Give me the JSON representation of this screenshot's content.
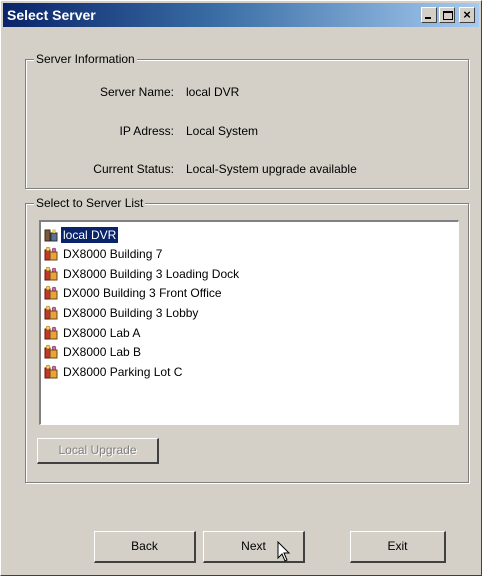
{
  "window": {
    "title": "Select Server"
  },
  "server_info": {
    "legend": "Server Information",
    "name_label": "Server Name:",
    "name_value": "local DVR",
    "ip_label": "IP Adress:",
    "ip_value": "Local System",
    "status_label": "Current Status:",
    "status_value": "Local-System upgrade available"
  },
  "server_list": {
    "legend": "Select to Server List",
    "items": [
      {
        "label": "local DVR",
        "icon": "dvr-icon"
      },
      {
        "label": "DX8000 Building 7",
        "icon": "server-icon"
      },
      {
        "label": "DX8000 Building 3 Loading Dock",
        "icon": "server-icon"
      },
      {
        "label": "DX000 Building 3 Front Office",
        "icon": "server-icon"
      },
      {
        "label": "DX8000 Building 3 Lobby",
        "icon": "server-icon"
      },
      {
        "label": "DX8000 Lab A",
        "icon": "server-icon"
      },
      {
        "label": "DX8000 Lab B",
        "icon": "server-icon"
      },
      {
        "label": "DX8000 Parking Lot C",
        "icon": "server-icon"
      }
    ],
    "selected_index": 0
  },
  "buttons": {
    "local_upgrade": "Local Upgrade",
    "back": "Back",
    "next": "Next",
    "exit": "Exit"
  },
  "colors": {
    "title_start": "#0a246a",
    "title_end": "#a6caf0",
    "selection": "#0a246a"
  }
}
